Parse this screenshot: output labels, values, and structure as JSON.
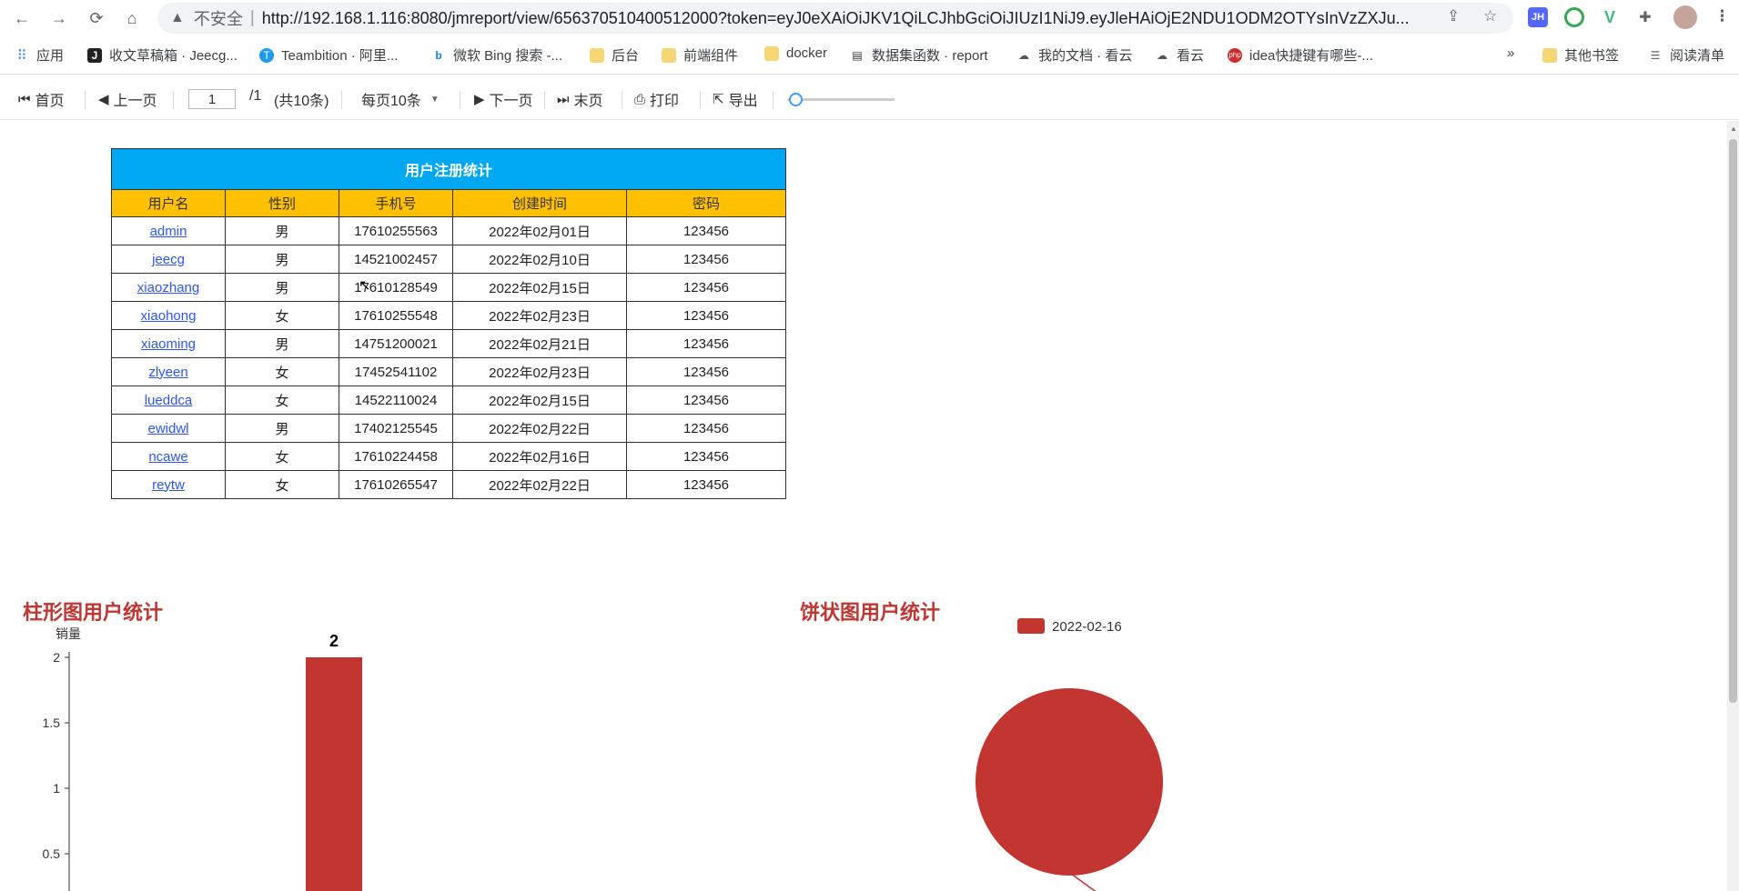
{
  "browser": {
    "insecure_label": "不安全",
    "url": "http://192.168.1.116:8080/jmreport/view/656370510400512000?token=eyJ0eXAiOiJKV1QiLCJhbGciOiJIUzI1NiJ9.eyJleHAiOjE2NDU1ODM2OTYsInVzZXJu...",
    "bookmarks": [
      {
        "label": "应用",
        "icon": "apps-grid-icon"
      },
      {
        "label": "收文草稿箱 · Jeecg...",
        "icon": "jeecg-j-icon"
      },
      {
        "label": "Teambition · 阿里...",
        "icon": "teambition-icon"
      },
      {
        "label": "微软 Bing 搜索 -...",
        "icon": "bing-icon"
      },
      {
        "label": "后台",
        "icon": "folder-icon"
      },
      {
        "label": "前端组件",
        "icon": "folder-icon"
      },
      {
        "label": "docker",
        "icon": "folder-icon"
      },
      {
        "label": "数据集函数 · report",
        "icon": "book-icon"
      },
      {
        "label": "我的文档 · 看云",
        "icon": "kanyun-icon"
      },
      {
        "label": "看云",
        "icon": "kanyun-icon"
      },
      {
        "label": "idea快捷键有哪些-...",
        "icon": "php-icon"
      }
    ],
    "more_label": "»",
    "other_bookmarks": "其他书签",
    "reading_list": "阅读清单"
  },
  "toolbar": {
    "first": "首页",
    "prev": "上一页",
    "page_value": "1",
    "page_total": "/1",
    "count": "(共10条)",
    "page_size": "每页10条",
    "next": "下一页",
    "last": "末页",
    "print": "打印",
    "export": "导出",
    "zoom_level": 0.05
  },
  "report_table": {
    "title": "用户注册统计",
    "headers": [
      "用户名",
      "性别",
      "手机号",
      "创建时间",
      "密码"
    ],
    "rows": [
      [
        "admin",
        "男",
        "17610255563",
        "2022年02月01日",
        "123456"
      ],
      [
        "jeecg",
        "男",
        "14521002457",
        "2022年02月10日",
        "123456"
      ],
      [
        "xiaozhang",
        "男",
        "17610128549",
        "2022年02月15日",
        "123456"
      ],
      [
        "xiaohong",
        "女",
        "17610255548",
        "2022年02月23日",
        "123456"
      ],
      [
        "xiaoming",
        "男",
        "14751200021",
        "2022年02月21日",
        "123456"
      ],
      [
        "zlyeen",
        "女",
        "17452541102",
        "2022年02月23日",
        "123456"
      ],
      [
        "lueddca",
        "女",
        "14522110024",
        "2022年02月15日",
        "123456"
      ],
      [
        "ewidwl",
        "男",
        "17402125545",
        "2022年02月22日",
        "123456"
      ],
      [
        "ncawe",
        "女",
        "17610224458",
        "2022年02月16日",
        "123456"
      ],
      [
        "reytw",
        "女",
        "17610265547",
        "2022年02月22日",
        "123456"
      ]
    ]
  },
  "bar_chart": {
    "title": "柱形图用户统计",
    "ylabel": "销量",
    "ticks": [
      "2",
      "1.5",
      "1",
      "0.5"
    ],
    "value_label": "2",
    "color": "#c23531"
  },
  "pie_chart": {
    "title": "饼状图用户统计",
    "legend": "2022-02-16",
    "slice_label": "2022-02-16",
    "color": "#c23531"
  },
  "chart_data": [
    {
      "type": "bar",
      "title": "柱形图用户统计",
      "ylabel": "销量",
      "xlabel": "",
      "categories": [
        ""
      ],
      "values": [
        2
      ],
      "ylim": [
        0,
        2
      ],
      "grid": false
    },
    {
      "type": "pie",
      "title": "饼状图用户统计",
      "categories": [
        "2022-02-16"
      ],
      "values": [
        1
      ],
      "legend": "top"
    }
  ]
}
